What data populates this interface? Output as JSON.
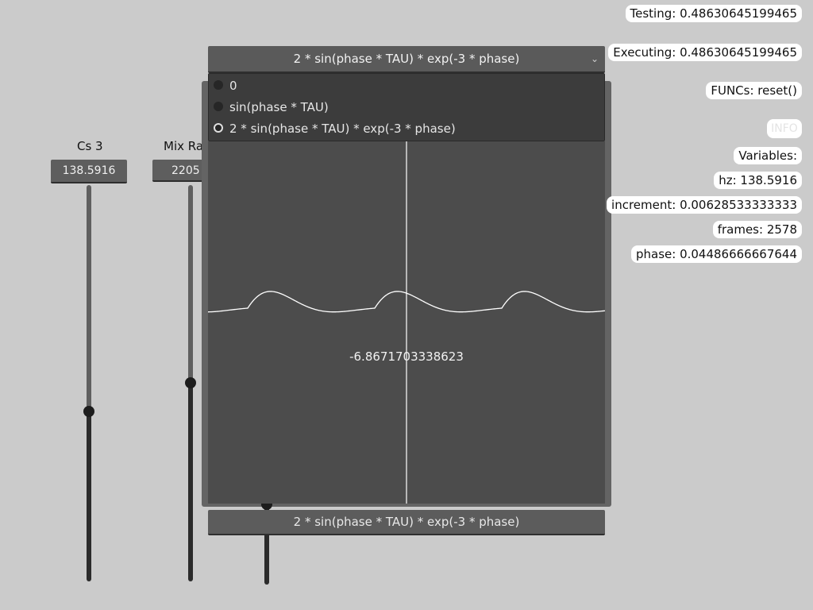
{
  "sliders": [
    {
      "label": "Cs 3",
      "value": "138.5916",
      "level": 0.5
    },
    {
      "label": "Mix Ra",
      "value": "2205",
      "level": 0.5
    },
    {
      "label": "",
      "value": "",
      "level": 0.98
    }
  ],
  "dropdown": {
    "selected": "2 * sin(phase * TAU) * exp(-3 * phase)",
    "options": [
      {
        "label": "0",
        "selected": false
      },
      {
        "label": "sin(phase * TAU)",
        "selected": false
      },
      {
        "label": "2 * sin(phase * TAU) * exp(-3 * phase)",
        "selected": true
      }
    ]
  },
  "scope": {
    "value": "-6.8671703338623",
    "line_color": "#ffffff"
  },
  "bottom_bar": {
    "label": "2 * sin(phase * TAU) * exp(-3 * phase)"
  },
  "info": {
    "testing": "Testing: 0.48630645199465",
    "executing": "Executing: 0.48630645199465",
    "funcs": "FUNCs: reset()",
    "info_button": "INFO",
    "variables": "Variables:",
    "hz": "hz: 138.5916",
    "increment": "increment: 0.00628533333333",
    "frames": "frames: 2578",
    "phase": "phase: 0.04486666667644"
  },
  "colors": {
    "background": "#cbcbcb",
    "panel": "#646464",
    "scope_bg": "#4c4c4c",
    "dropdown_list": "#3c3c3c"
  }
}
